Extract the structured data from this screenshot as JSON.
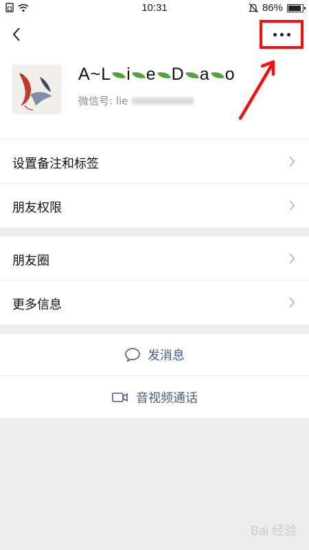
{
  "status_bar": {
    "time": "10:31",
    "battery": "86%",
    "icons": [
      "sim-icon",
      "wifi-icon",
      "mute-bell-icon",
      "battery-icon"
    ]
  },
  "nav": {
    "back_icon": "chevron-left-icon",
    "more_icon": "more-dots-icon"
  },
  "profile": {
    "name_parts": [
      "A~L",
      "i",
      "e",
      "D",
      "a",
      "o"
    ],
    "wechat_id_label": "微信号: lie"
  },
  "menu_group_1": [
    {
      "label": "设置备注和标签"
    },
    {
      "label": "朋友权限"
    }
  ],
  "menu_group_2": [
    {
      "label": "朋友圈"
    },
    {
      "label": "更多信息"
    }
  ],
  "actions": {
    "send_message": "发消息",
    "av_call": "音视频通话"
  },
  "watermark": "Bai 经验",
  "colors": {
    "background": "#ededed",
    "action_text": "#4a5b82",
    "highlight": "#ff0a0a",
    "leaf": "#4fa33a"
  }
}
